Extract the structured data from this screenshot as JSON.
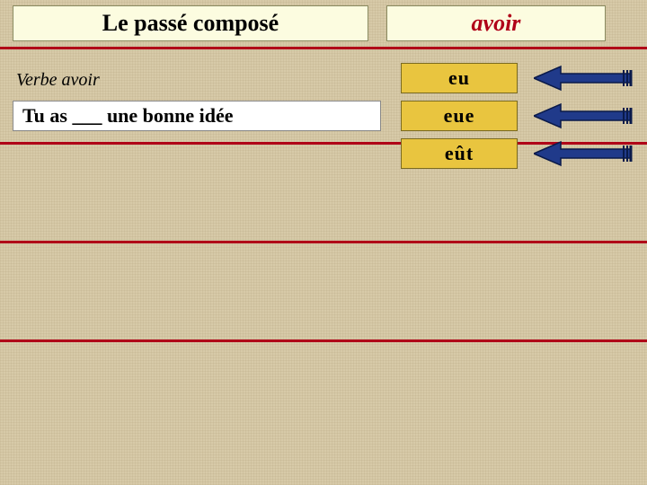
{
  "header": {
    "title": "Le passé composé",
    "verb_title": "avoir"
  },
  "question": {
    "verb_label": "Verbe avoir",
    "sentence": "Tu as ___ une bonne idée"
  },
  "options": [
    {
      "text": "eu"
    },
    {
      "text": "eue"
    },
    {
      "text": "eût"
    }
  ],
  "layout": {
    "rule_y": [
      52,
      158,
      268,
      378
    ],
    "option_y": [
      70,
      112,
      154
    ]
  },
  "colors": {
    "rule": "#b00018",
    "arrow_fill": "#203a8a",
    "arrow_stroke": "#0a1a4a",
    "option_bg": "#e9c53f"
  }
}
